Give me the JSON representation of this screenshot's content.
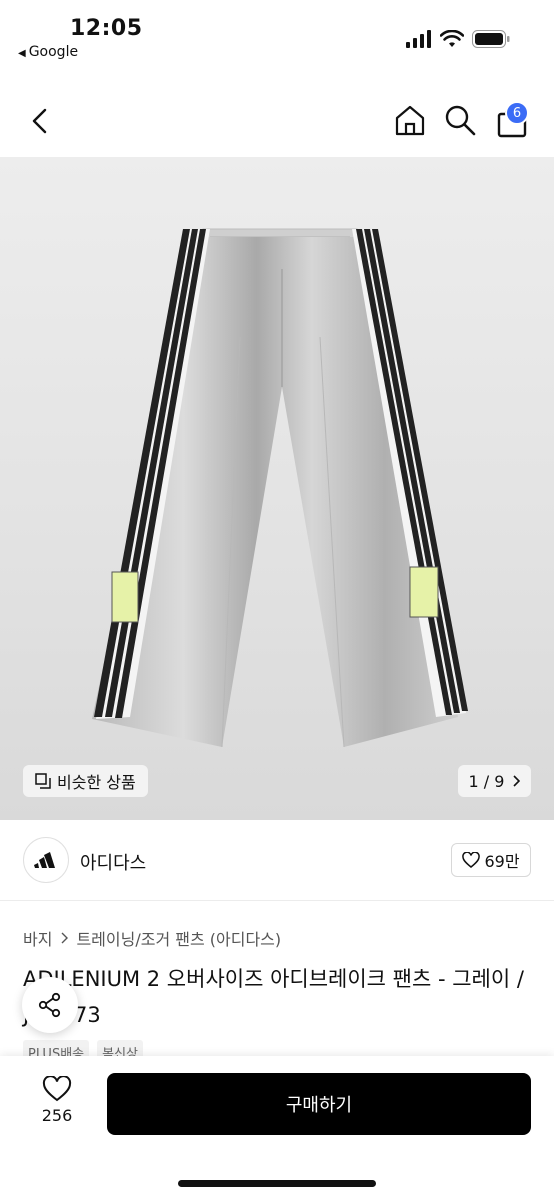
{
  "status_bar": {
    "time": "12:05",
    "back_app": "Google"
  },
  "nav": {
    "cart_count": "6"
  },
  "gallery": {
    "similar_label": "비슷한 상품",
    "pager": "1 / 9"
  },
  "brand": {
    "name": "아디다스",
    "likes": "69만"
  },
  "breadcrumb": [
    "바지",
    "트레이닝/조거 팬츠 (아디다스)"
  ],
  "product": {
    "title": "ADILENIUM 2 오버사이즈 아디브레이크 팬츠 - 그레이 / JM9273",
    "tags": [
      "PLUS배송",
      "봄신상"
    ]
  },
  "bottom_bar": {
    "wish_count": "256",
    "buy_label": "구매하기"
  },
  "icons": [
    "back-icon",
    "home-icon",
    "search-icon",
    "cart-icon",
    "similar-icon",
    "chevron-right-icon",
    "heart-icon",
    "share-icon",
    "adidas-logo"
  ]
}
